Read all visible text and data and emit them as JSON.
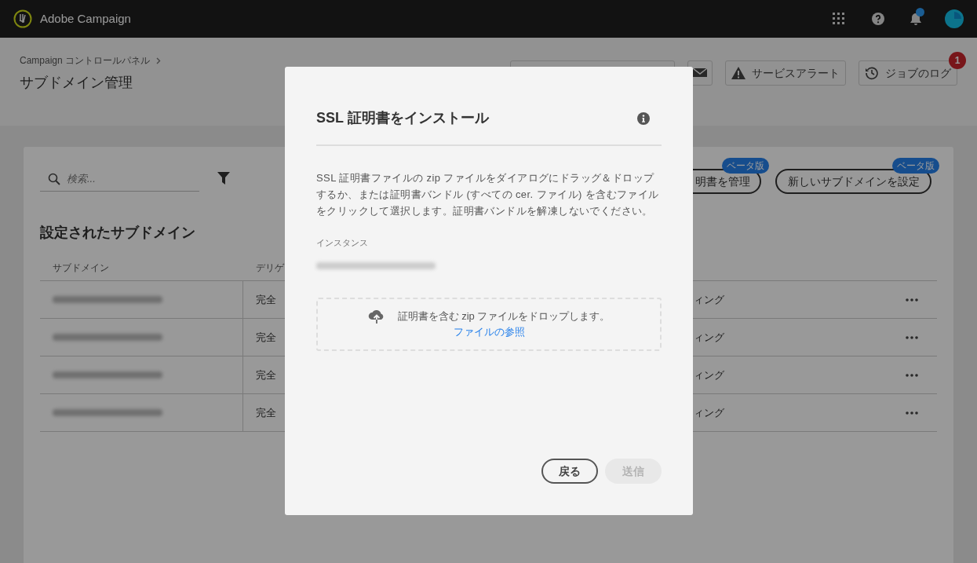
{
  "app": {
    "title": "Adobe Campaign",
    "notification_dot": true
  },
  "breadcrumb": [
    "Campaign コントロールパネル"
  ],
  "page_title": "サブドメイン管理",
  "header_buttons": [
    {
      "kind": "search"
    },
    {
      "kind": "mail"
    },
    {
      "kind": "alert",
      "label": "サービスアラート"
    },
    {
      "kind": "history",
      "label": "ジョブのログ",
      "badge": "1"
    }
  ],
  "card": {
    "search": {
      "placeholder": "検索..."
    },
    "actions": [
      {
        "label": "明書を管理",
        "badge": "ベータ版"
      },
      {
        "label": "新しいサブドメインを設定",
        "badge": "ベータ版"
      }
    ],
    "section_title": "設定されたサブドメイン",
    "columns": [
      "サブドメイン",
      "デリゲ"
    ],
    "rows": [
      {
        "delegation": "完全",
        "column_3": "ィング"
      },
      {
        "delegation": "完全",
        "column_3": "ィング"
      },
      {
        "delegation": "完全",
        "column_3": "ィング"
      },
      {
        "delegation": "完全",
        "column_3": "ィング"
      }
    ]
  },
  "dialog": {
    "title": "SSL 証明書をインストール",
    "description": "SSL 証明書ファイルの zip ファイルをダイアログにドラッグ＆ドロップするか、または証明書バンドル (すべての cer. ファイル) を含むファイルをクリックして選択します。証明書バンドルを解凍しないでください。",
    "instance_label": "インスタンス",
    "dropzone": {
      "text": "証明書を含む zip ファイルをドロップします。",
      "link": "ファイルの参照"
    },
    "buttons": [
      {
        "label": "戻る",
        "disabled": false
      },
      {
        "label": "送信",
        "disabled": true
      }
    ]
  }
}
